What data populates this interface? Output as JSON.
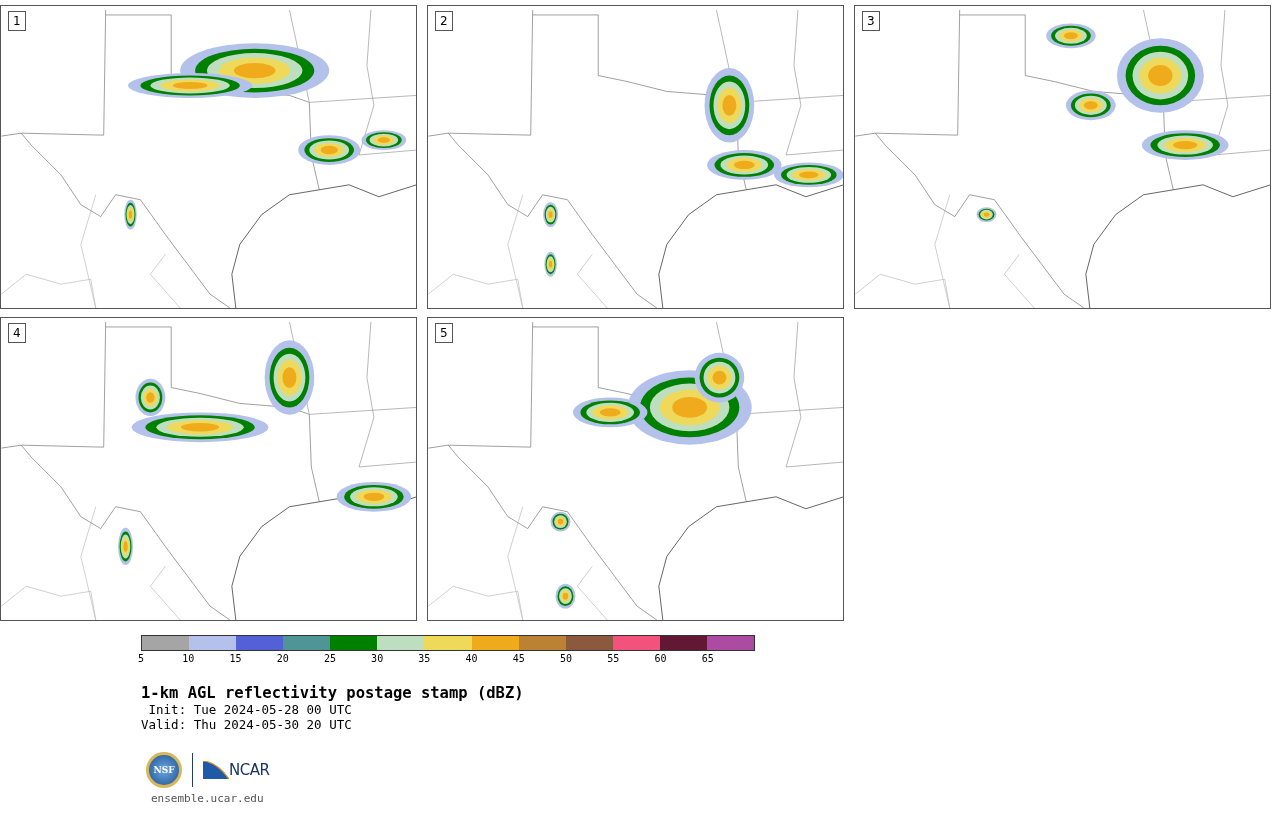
{
  "panels": [
    {
      "label": "1"
    },
    {
      "label": "2"
    },
    {
      "label": "3"
    },
    {
      "label": "4"
    },
    {
      "label": "5"
    }
  ],
  "colorbar": {
    "segments": [
      {
        "color": "#a5a5a5"
      },
      {
        "color": "#b4c1ea"
      },
      {
        "color": "#5262d6"
      },
      {
        "color": "#4f9596"
      },
      {
        "color": "#008000"
      },
      {
        "color": "#bedfbf"
      },
      {
        "color": "#efd95a"
      },
      {
        "color": "#efab1c"
      },
      {
        "color": "#bb8233"
      },
      {
        "color": "#8b5a3e"
      },
      {
        "color": "#f2527c"
      },
      {
        "color": "#621833"
      },
      {
        "color": "#ad4ba3"
      }
    ],
    "ticks": [
      "5",
      "10",
      "15",
      "20",
      "25",
      "30",
      "35",
      "40",
      "45",
      "50",
      "55",
      "60",
      "65"
    ]
  },
  "title": "1-km AGL reflectivity postage stamp (dBZ)",
  "init": " Init: Tue 2024-05-28 00 UTC",
  "valid": "Valid: Thu 2024-05-30 20 UTC",
  "logo": {
    "nsf": "NSF",
    "ncar": "NCAR"
  },
  "url": "ensemble.ucar.edu"
}
